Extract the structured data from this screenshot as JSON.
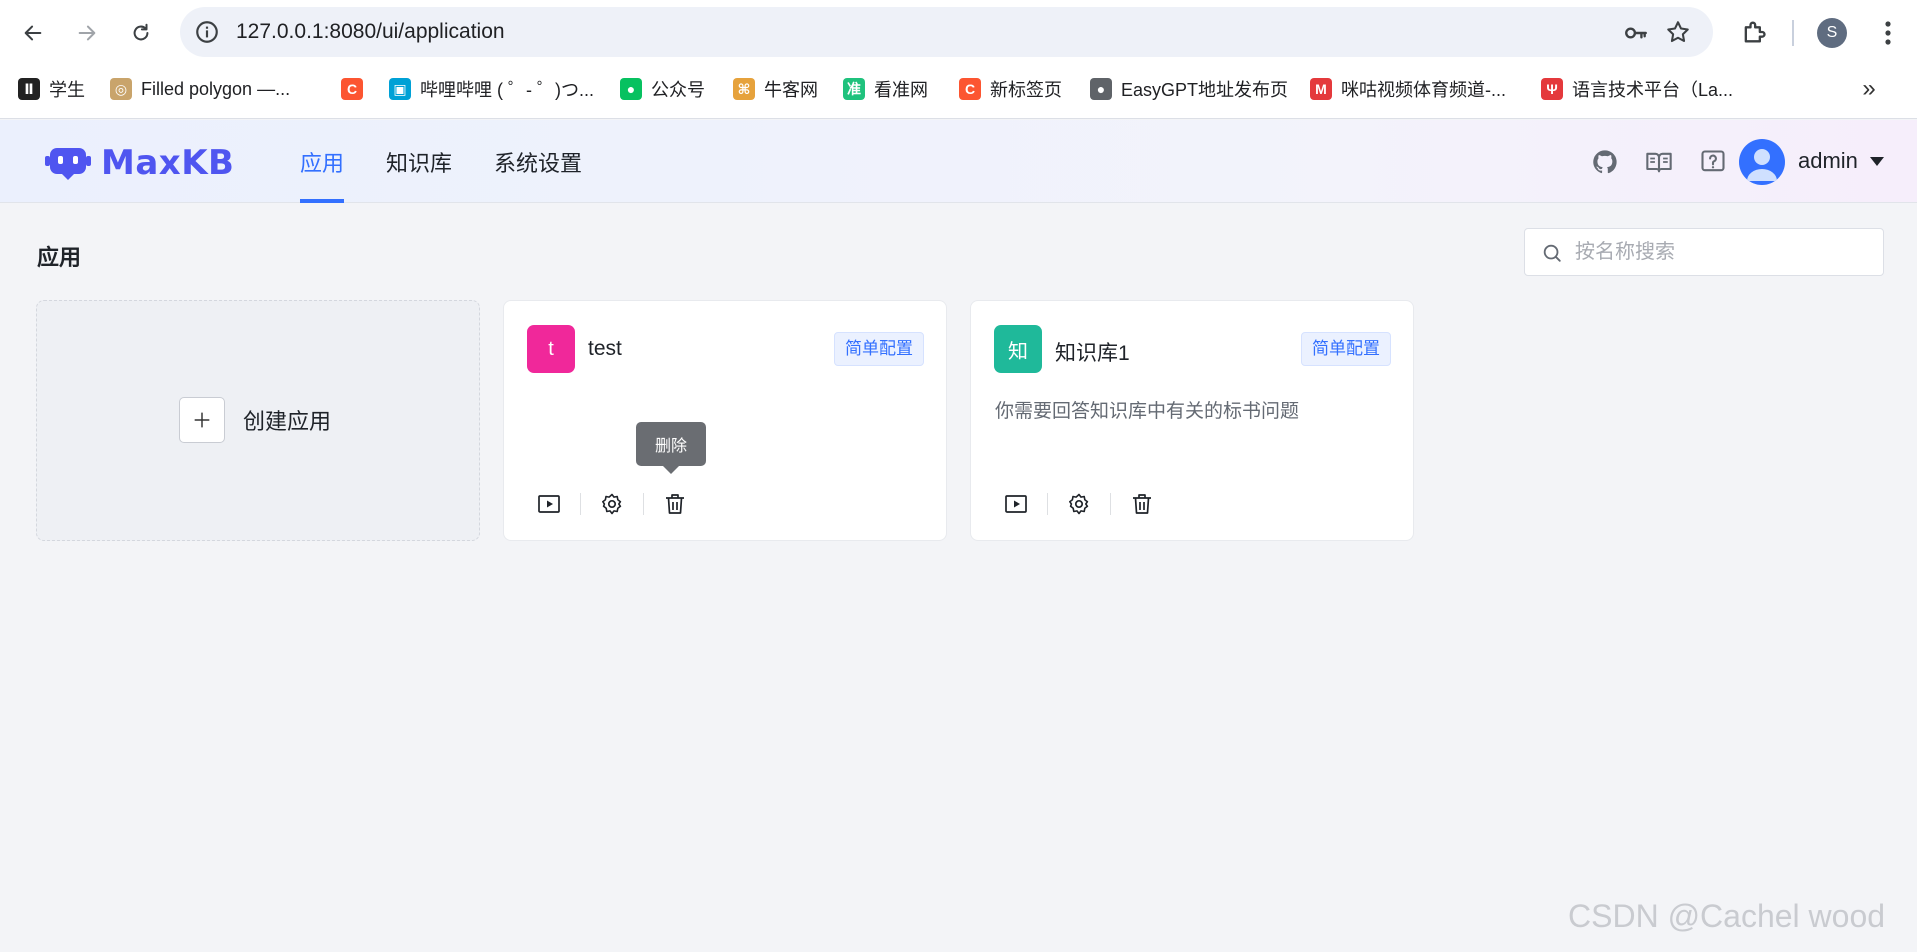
{
  "browser": {
    "url": "127.0.0.1:8080/ui/application",
    "profile_initial": "S",
    "bookmarks": [
      {
        "label": "学生",
        "icon": "xuesheng-icon",
        "color": "#222222",
        "glyph": "Ⅱ"
      },
      {
        "label": "Filled polygon —...",
        "icon": "matplotlib-icon",
        "color": "#c9a46b",
        "glyph": "◎"
      },
      {
        "label": "",
        "icon": "csdn-icon",
        "color": "#fc5531",
        "glyph": "C"
      },
      {
        "label": "哔哩哔哩 ( ゜- ゜)つ...",
        "icon": "bilibili-icon",
        "color": "#00a1d6",
        "glyph": "▣"
      },
      {
        "label": "公众号",
        "icon": "wechat-mp-icon",
        "color": "#07c160",
        "glyph": "●"
      },
      {
        "label": "牛客网",
        "icon": "nowcoder-icon",
        "color": "#e6a23c",
        "glyph": "⌘"
      },
      {
        "label": "看准网",
        "icon": "kanzhun-icon",
        "color": "#1fc27d",
        "glyph": "准"
      },
      {
        "label": "新标签页",
        "icon": "csdn-icon",
        "color": "#fc5531",
        "glyph": "C"
      },
      {
        "label": "EasyGPT地址发布页",
        "icon": "globe-icon",
        "color": "#5f6368",
        "glyph": "●"
      },
      {
        "label": "咪咕视频体育频道-...",
        "icon": "migu-icon",
        "color": "#e4393c",
        "glyph": "M"
      },
      {
        "label": "语言技术平台（La...",
        "icon": "ltp-icon",
        "color": "#e4393c",
        "glyph": "Ψ"
      }
    ]
  },
  "header": {
    "logo_text": "MaxKB",
    "nav": [
      {
        "label": "应用",
        "active": true
      },
      {
        "label": "知识库",
        "active": false
      },
      {
        "label": "系统设置",
        "active": false
      }
    ],
    "user": "admin"
  },
  "main": {
    "title": "应用",
    "search_placeholder": "按名称搜索",
    "create_label": "创建应用",
    "apps": [
      {
        "icon_text": "t",
        "icon_color": "#f0289a",
        "name": "test",
        "tag": "简单配置",
        "desc": ""
      },
      {
        "icon_text": "知",
        "icon_color": "#1fb99a",
        "name": "知识库1",
        "tag": "简单配置",
        "desc": "你需要回答知识库中有关的标书问题"
      }
    ],
    "tooltip": "删除"
  },
  "watermark": "CSDN @Cachel wood",
  "colors": {
    "accent": "#3370ff",
    "logo": "#4f55f0"
  }
}
